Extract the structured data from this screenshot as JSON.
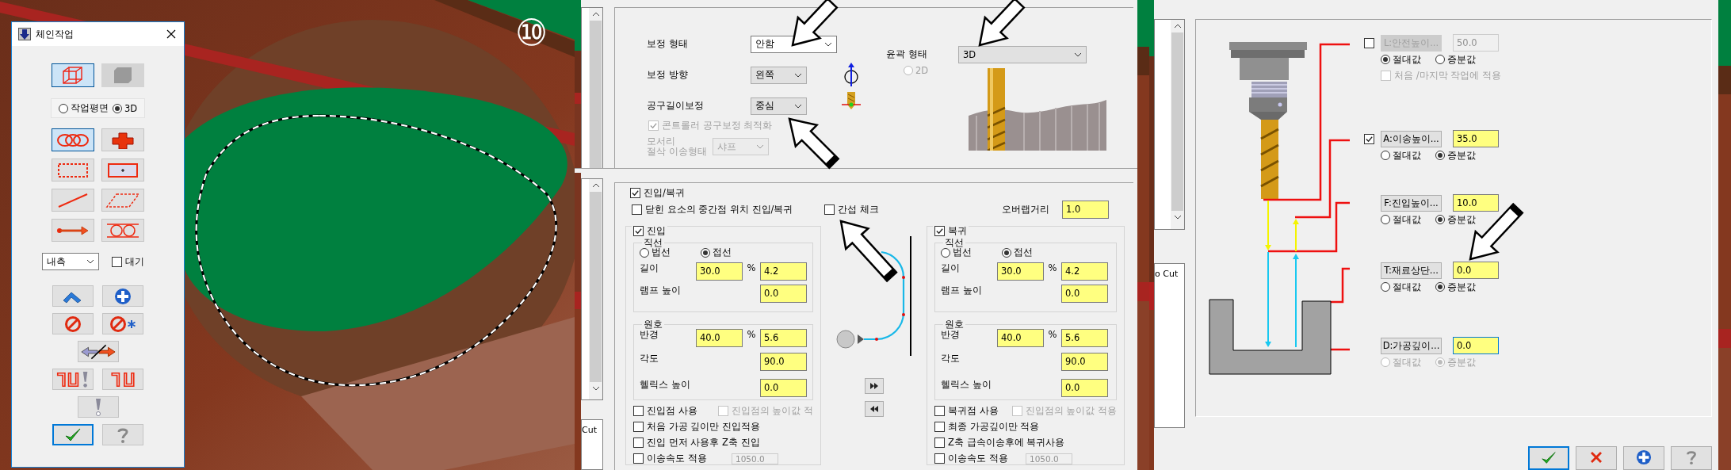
{
  "viewport": {
    "step_badge": "⑩"
  },
  "chain_dialog": {
    "title": "체인작업",
    "display_modes": [
      {
        "selected": true,
        "disabled": false
      },
      {
        "selected": false,
        "disabled": true
      }
    ],
    "plane_options": [
      {
        "label": "작업평면",
        "selected": false
      },
      {
        "label": "3D",
        "selected": true
      }
    ],
    "chain_tools": [
      {
        "selected": true
      },
      {
        "selected": false
      },
      {
        "selected": false
      },
      {
        "selected": false
      },
      {
        "selected": false
      },
      {
        "selected": false
      },
      {
        "selected": false
      },
      {
        "selected": false
      }
    ],
    "side_dropdown": {
      "value": "내측"
    },
    "wait_checkbox": {
      "label": "대기",
      "checked": false
    }
  },
  "compensation": {
    "fields": [
      {
        "label": "보정 형태",
        "value": "안함",
        "focused": true
      },
      {
        "label": "보정 방향",
        "value": "왼쪽",
        "focused": false
      },
      {
        "label": "공구길이보정",
        "value": "중심",
        "focused": false
      }
    ],
    "optimize_checkbox": {
      "label": "콘트롤러 공구보정 최적화",
      "checked": true,
      "disabled": true
    },
    "corner": {
      "label_lines": [
        "모서리",
        "절삭 이송형태"
      ],
      "value": "샤프",
      "disabled": true
    },
    "contour": {
      "label": "윤곽 형태",
      "value": "3D"
    },
    "mode_2d": {
      "label": "2D",
      "selected": false,
      "disabled": true
    }
  },
  "lead": {
    "list_text": "Cut",
    "enabled": {
      "label": "진입/복귀",
      "checked": true
    },
    "midpoint": {
      "label": "닫힌 요소의 중간점  위치 진입/복귀",
      "checked": false
    },
    "interference": {
      "label": "간섭 체크",
      "checked": false
    },
    "overlap": {
      "label": "오버랩거리",
      "value": "1.0"
    },
    "sides": [
      {
        "label": "진입",
        "checked": true,
        "line_title": "직선",
        "line_modes": [
          {
            "label": "법선",
            "selected": false
          },
          {
            "label": "접선",
            "selected": true
          }
        ],
        "length": {
          "label": "길이",
          "value": "30.0",
          "unit": "%",
          "percent": "4.2"
        },
        "ramp": {
          "label": "램프 높이",
          "value": "0.0"
        },
        "arc_title": "원호",
        "radius": {
          "label": "반경",
          "value": "40.0",
          "unit": "%",
          "percent": "5.6"
        },
        "angle": {
          "label": "각도",
          "value": "90.0"
        },
        "helix": {
          "label": "헬릭스 높이",
          "value": "0.0"
        },
        "point_options": [
          {
            "label": "진입점 사용",
            "checked": false,
            "disabled": false
          },
          {
            "label": "진입점의 높이값 적",
            "checked": false,
            "disabled": true
          }
        ],
        "options": [
          {
            "label": "처음 가공 깊이만 진입적용",
            "checked": false
          },
          {
            "label": "진입 먼저 사용후 Z축 진입",
            "checked": false
          }
        ],
        "feed": {
          "label": "이송속도 적용",
          "checked": false,
          "value": "1050.0"
        }
      },
      {
        "label": "복귀",
        "checked": true,
        "line_title": "직선",
        "line_modes": [
          {
            "label": "법선",
            "selected": false
          },
          {
            "label": "접선",
            "selected": true
          }
        ],
        "length": {
          "label": "길이",
          "value": "30.0",
          "unit": "%",
          "percent": "4.2"
        },
        "ramp": {
          "label": "램프 높이",
          "value": "0.0"
        },
        "arc_title": "원호",
        "radius": {
          "label": "반경",
          "value": "40.0",
          "unit": "%",
          "percent": "5.6"
        },
        "angle": {
          "label": "각도",
          "value": "90.0"
        },
        "helix": {
          "label": "헬릭스 높이",
          "value": "0.0"
        },
        "point_options": [
          {
            "label": "복귀점 사용",
            "checked": false,
            "disabled": false
          },
          {
            "label": "진입점의 높이값 적용",
            "checked": false,
            "disabled": true
          }
        ],
        "options": [
          {
            "label": "최종 가공깊이만 적용",
            "checked": false
          },
          {
            "label": "Z축 급속이송후에 복귀사용",
            "checked": false
          }
        ],
        "feed": {
          "label": "이송속도 적용",
          "checked": false,
          "value": "1050.0"
        }
      }
    ]
  },
  "heights": {
    "list_text": "o Cut",
    "rows": [
      {
        "kind": "checkable",
        "checked": false,
        "button": "L:안전높이...",
        "value": "50.0",
        "disabled": true,
        "focused": false,
        "modes_disabled": false,
        "modes": [
          {
            "label": "절대값",
            "selected": true
          },
          {
            "label": "증분값",
            "selected": false
          }
        ],
        "extra": {
          "label": "처음 /마지막 작업에 적용",
          "checked": false,
          "disabled": true
        }
      },
      {
        "kind": "checkable",
        "checked": true,
        "button": "A:이송높이...",
        "value": "35.0",
        "disabled": false,
        "focused": false,
        "modes_disabled": false,
        "modes": [
          {
            "label": "절대값",
            "selected": false
          },
          {
            "label": "증분값",
            "selected": true
          }
        ]
      },
      {
        "kind": "plain",
        "button": "F:진입높이...",
        "value": "10.0",
        "disabled": false,
        "focused": false,
        "modes_disabled": false,
        "modes": [
          {
            "label": "절대값",
            "selected": false
          },
          {
            "label": "증분값",
            "selected": true
          }
        ]
      },
      {
        "kind": "plain",
        "button": "T:재료상단...",
        "value": "0.0",
        "disabled": false,
        "focused": false,
        "modes_disabled": false,
        "modes": [
          {
            "label": "절대값",
            "selected": false
          },
          {
            "label": "증분값",
            "selected": true
          }
        ]
      },
      {
        "kind": "plain",
        "button": "D:가공깊이...",
        "value": "0.0",
        "disabled": false,
        "focused": true,
        "modes_disabled": true,
        "modes": [
          {
            "label": "절대값",
            "selected": false
          },
          {
            "label": "증분값",
            "selected": true
          }
        ]
      }
    ]
  }
}
